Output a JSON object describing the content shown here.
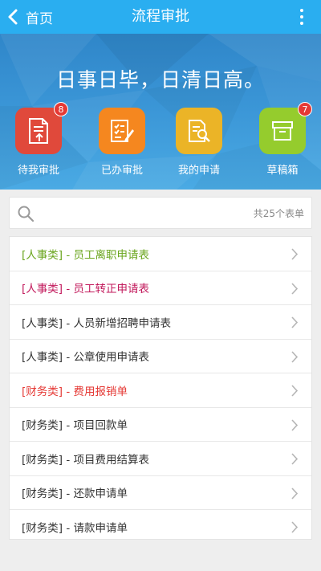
{
  "nav": {
    "back_label": "首页",
    "title": "流程审批"
  },
  "banner": {
    "slogan": "日事日毕，日清日高。"
  },
  "actions": [
    {
      "label": "待我审批",
      "icon": "document-upload-icon",
      "color": "#e0493b",
      "badge": "8"
    },
    {
      "label": "已办审批",
      "icon": "checklist-edit-icon",
      "color": "#f5871f",
      "badge": ""
    },
    {
      "label": "我的申请",
      "icon": "document-search-icon",
      "color": "#ebb427",
      "badge": ""
    },
    {
      "label": "草稿箱",
      "icon": "archive-box-icon",
      "color": "#95cc2d",
      "badge": "7"
    }
  ],
  "search": {
    "placeholder": "",
    "count_text": "共25个表单"
  },
  "forms": [
    {
      "text": "[人事类] - 员工离职申请表",
      "color": "#6aa51d"
    },
    {
      "text": "[人事类] - 员工转正申请表",
      "color": "#c2185b"
    },
    {
      "text": "[人事类] - 人员新增招聘申请表",
      "color": "#333333"
    },
    {
      "text": "[人事类] - 公章使用申请表",
      "color": "#333333"
    },
    {
      "text": "[财务类] - 费用报销单",
      "color": "#e53935"
    },
    {
      "text": "[财务类] - 项目回款单",
      "color": "#333333"
    },
    {
      "text": "[财务类] - 项目费用结算表",
      "color": "#333333"
    },
    {
      "text": "[财务类] - 还款申请单",
      "color": "#333333"
    },
    {
      "text": "[财务类] - 请款申请单",
      "color": "#333333"
    }
  ]
}
